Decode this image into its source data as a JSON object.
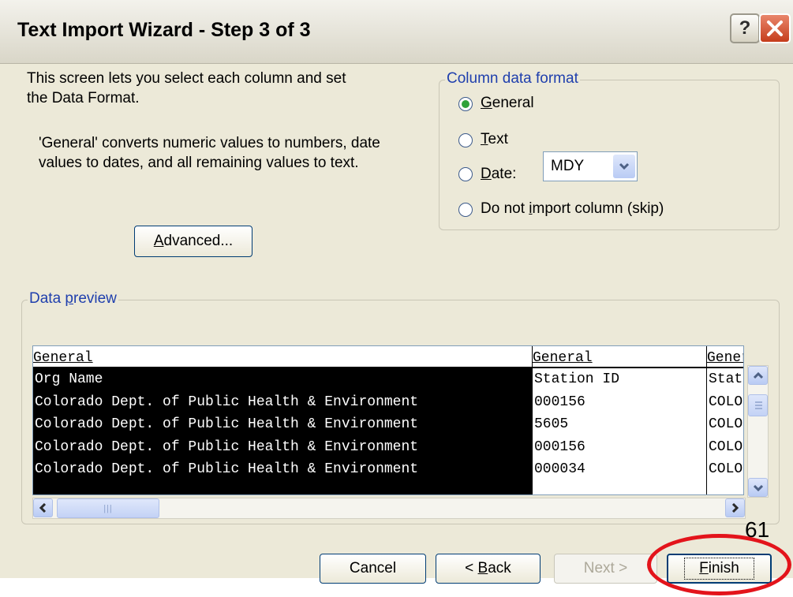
{
  "window": {
    "title": "Text Import Wizard - Step 3 of 3",
    "help_label": "?",
    "close_label": "✕"
  },
  "intro": {
    "line1": "This screen lets you select each column and set",
    "line2": "the Data Format.",
    "desc1": "'General' converts numeric values to numbers, date",
    "desc2": "values to dates, and all remaining values to text."
  },
  "advanced_button": {
    "label_pre": "",
    "label_key": "A",
    "label_rest": "dvanced..."
  },
  "column_format": {
    "legend": "Column data format",
    "selected": "General",
    "options": [
      {
        "key": "G",
        "rest": "eneral",
        "pre": ""
      },
      {
        "key": "T",
        "rest": "ext",
        "pre": ""
      },
      {
        "key": "D",
        "rest": "ate:",
        "pre": ""
      },
      {
        "pre": "Do not ",
        "key": "i",
        "rest": "mport column (skip)"
      }
    ],
    "date_format": "MDY"
  },
  "data_preview": {
    "legend_pre": "Data ",
    "legend_key": "p",
    "legend_rest": "review",
    "columns": [
      {
        "header": "General",
        "cells": [
          "Org Name",
          "Colorado Dept. of Public Health & Environment",
          "Colorado Dept. of Public Health & Environment",
          "Colorado Dept. of Public Health & Environment",
          "Colorado Dept. of Public Health & Environment"
        ]
      },
      {
        "header": "General",
        "cells": [
          "Station ID",
          "000156",
          "5605",
          "000156",
          "000034"
        ]
      },
      {
        "header": "General",
        "cells": [
          "Station",
          "COLO",
          "COLO",
          "COLO",
          "COLO"
        ]
      }
    ],
    "scroll_grip": "|||"
  },
  "buttons": {
    "cancel": "Cancel",
    "back_pre": "< ",
    "back_key": "B",
    "back_rest": "ack",
    "next": "Next >",
    "finish_key": "F",
    "finish_rest": "inish"
  },
  "annotation": {
    "number": "61"
  },
  "colors": {
    "accent_ring": "#e3141b",
    "groupbox_label": "#1f3fad",
    "radio_selected": "#2fa23a"
  }
}
